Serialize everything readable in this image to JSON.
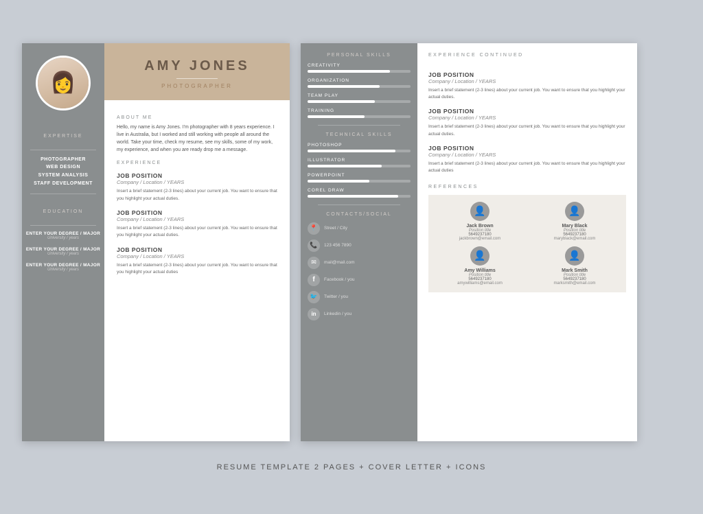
{
  "caption": "RESUME TEMPLATE 2 PAGES + COVER LETTER + ICONS",
  "page1": {
    "sidebar": {
      "expertise_label": "EXPERTISE",
      "skills": [
        "PHOTOGRAPHER",
        "WEB DESIGN",
        "SYSTEM ANALYSIS",
        "STAFF DEVELOPMENT"
      ],
      "education_label": "EDUCATION",
      "degrees": [
        {
          "title": "ENTER YOUR DEGREE / MAJOR",
          "sub": "University / years"
        },
        {
          "title": "ENTER YOUR DEGREE / MAJOR",
          "sub": "University / years"
        },
        {
          "title": "ENTER YOUR DEGREE / MAJOR",
          "sub": "University / years"
        }
      ]
    },
    "header": {
      "name": "AMY JONES",
      "subtitle": "PHOTOGRAPHER"
    },
    "about": {
      "label": "ABOUT ME",
      "text": "Hello, my name is Amy Jones. I'm photographer with 8 years experience. I live in Australia, but I worked and still working with people all around the world. Take your time, check my resume, see my skills, some of my work, my experience, and when you are ready drop me a message."
    },
    "experience": {
      "label": "EXPERIENCE",
      "jobs": [
        {
          "title": "JOB POSITION",
          "company": "Company / Location / YEARS",
          "desc": "Insert a brief statement (2-3 lines) about your current job. You want to ensure that you highlight your actual duties."
        },
        {
          "title": "JOB POSITION",
          "company": "Company / Location / YEARS",
          "desc": "Insert a brief statement (2-3 lines) about your current job. You want to ensure that you highlight your actual duties."
        },
        {
          "title": "JOB POSITION",
          "company": "Company / Location / YEARS",
          "desc": "Insert a brief statement (2-3 lines) about your current job. You want to ensure that you highlight your actual duties"
        }
      ]
    }
  },
  "page2": {
    "personal_skills": {
      "label": "PERSONAL SKILLS",
      "skills": [
        {
          "name": "CREATIVITY",
          "pct": 80
        },
        {
          "name": "ORGANIZATION",
          "pct": 70
        },
        {
          "name": "TEAM PLAY",
          "pct": 65
        },
        {
          "name": "TRAINING",
          "pct": 55
        }
      ]
    },
    "technical_skills": {
      "label": "TECHNICAL SKILLS",
      "skills": [
        {
          "name": "PHOTOSHOP",
          "pct": 85
        },
        {
          "name": "ILLUSTRATOR",
          "pct": 72
        },
        {
          "name": "POWERPOINT",
          "pct": 60
        },
        {
          "name": "COREL DRAW",
          "pct": 88
        }
      ]
    },
    "contacts": {
      "label": "CONTACTS/SOCIAL",
      "items": [
        {
          "icon": "📍",
          "text": "Street / City"
        },
        {
          "icon": "📞",
          "text": "123 456 7890"
        },
        {
          "icon": "✉",
          "text": "mail@mail.com"
        },
        {
          "icon": "f",
          "text": "Facebook / you"
        },
        {
          "icon": "🐦",
          "text": "Twitter / you"
        },
        {
          "icon": "in",
          "text": "Linkedin / you"
        }
      ]
    },
    "experience_continued": {
      "label": "EXPERIENCE CONTINUED",
      "jobs": [
        {
          "title": "JOB POSITION",
          "company": "Company / Location / YEARS",
          "desc": "Insert a brief statement (2-3 lines) about your current job. You want to ensure that you highlight your actual duties."
        },
        {
          "title": "JOB POSITION",
          "company": "Company / Location / YEARS",
          "desc": "Insert a brief statement (2-3 lines) about your current job. You want to ensure that you highlight your actual duties."
        },
        {
          "title": "JOB POSITION",
          "company": "Company / Location / YEARS",
          "desc": "Insert a brief statement (2-3 lines) about your current job. You want to ensure that you highlight your actual duties"
        }
      ]
    },
    "references": {
      "label": "REFERENCES",
      "people": [
        {
          "name": "Jack Brown",
          "pos": "Position title",
          "phone": "5649237180",
          "email": "jackbrown@email.com"
        },
        {
          "name": "Mary Black",
          "pos": "Position title",
          "phone": "5649237180",
          "email": "maryblack@email.com"
        },
        {
          "name": "Amy Williams",
          "pos": "Position title",
          "phone": "5649237180",
          "email": "amywilliams@email.com"
        },
        {
          "name": "Mark Smith",
          "pos": "Position title",
          "phone": "5649237180",
          "email": "marksmith@email.com"
        }
      ]
    }
  }
}
